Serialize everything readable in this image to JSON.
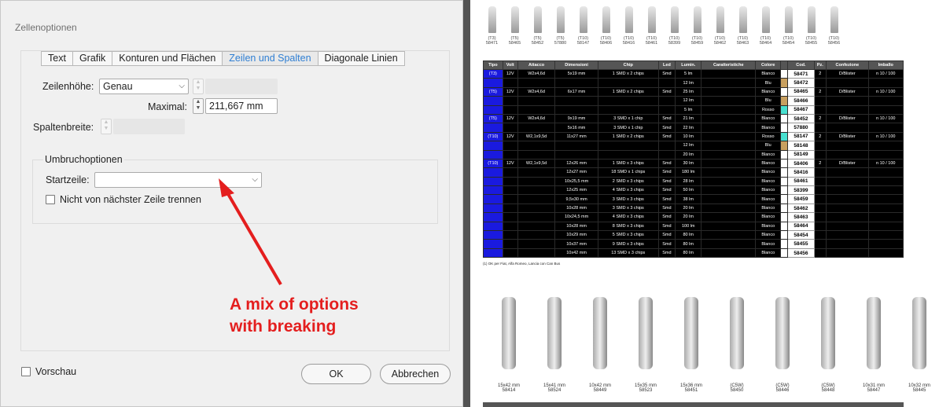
{
  "dialog": {
    "title": "Zellenoptionen",
    "tabs": [
      {
        "label": "Text"
      },
      {
        "label": "Grafik"
      },
      {
        "label": "Konturen und Flächen"
      },
      {
        "label": "Zeilen und Spalten",
        "active": true
      },
      {
        "label": "Diagonale Linien"
      }
    ],
    "row_height_label": "Zeilenhöhe:",
    "row_height_value": "Genau",
    "max_label": "Maximal:",
    "max_value": "211,667 mm",
    "col_width_label": "Spaltenbreite:",
    "break_group_title": "Umbruchoptionen",
    "start_row_label": "Startzeile:",
    "start_row_value": "",
    "keep_with_next_label": "Nicht von nächster Zeile trennen",
    "preview_label": "Vorschau",
    "ok_label": "OK",
    "cancel_label": "Abbrechen"
  },
  "annotation": {
    "line1": "A mix of options",
    "line2": "with breaking",
    "color": "#e41e1e"
  },
  "document": {
    "products": [
      {
        "type": "(T3)",
        "code": "58471"
      },
      {
        "type": "(T5)",
        "code": "58465"
      },
      {
        "type": "(T5)",
        "code": "58452"
      },
      {
        "type": "(T5)",
        "code": "57880"
      },
      {
        "type": "(T10)",
        "code": "58147"
      },
      {
        "type": "(T10)",
        "code": "58406"
      },
      {
        "type": "(T10)",
        "code": "58416"
      },
      {
        "type": "(T10)",
        "code": "58461"
      },
      {
        "type": "(T10)",
        "code": "58399"
      },
      {
        "type": "(T10)",
        "code": "58459"
      },
      {
        "type": "(T10)",
        "code": "58462"
      },
      {
        "type": "(T10)",
        "code": "58463"
      },
      {
        "type": "(T10)",
        "code": "58464"
      },
      {
        "type": "(T10)",
        "code": "58454"
      },
      {
        "type": "(T10)",
        "code": "58455"
      },
      {
        "type": "(T10)",
        "code": "58456"
      }
    ],
    "table_headers": [
      "Tipo",
      "Volt",
      "Attacco",
      "Dimensioni",
      "Chip",
      "Led",
      "Lumin.",
      "Caratteristiche",
      "Colore",
      "",
      "Cod.",
      "Pz.",
      "Confezione",
      "Imballo"
    ],
    "rows": [
      {
        "tipo": "(T3)",
        "volt": "12V",
        "att": "W2x4,6d",
        "dim": "5x19 mm",
        "chip": "1 SMD x 2 chips",
        "led": "Smd",
        "lum": "5 lm",
        "col": "Blanco",
        "cod": "58471",
        "pz": "2",
        "conf": "D/Blister",
        "imb": "n 10 / 100"
      },
      {
        "tipo": "",
        "volt": "",
        "att": "",
        "dim": "",
        "chip": "",
        "led": "",
        "lum": "12 lm",
        "col": "Blu",
        "cod": "58472",
        "pz": "",
        "conf": "",
        "imb": ""
      },
      {
        "tipo": "(T5)",
        "volt": "12V",
        "att": "W2x4,6d",
        "dim": "6x17 mm",
        "chip": "1 SMD x 2 chips",
        "led": "Smd",
        "lum": "25 lm",
        "col": "Blanco",
        "cod": "58465",
        "pz": "2",
        "conf": "D/Blister",
        "imb": "n 10 / 100"
      },
      {
        "tipo": "",
        "volt": "",
        "att": "",
        "dim": "",
        "chip": "",
        "led": "",
        "lum": "12 lm",
        "col": "Blu",
        "cod": "58466",
        "pz": "",
        "conf": "",
        "imb": ""
      },
      {
        "tipo": "",
        "volt": "",
        "att": "",
        "dim": "",
        "chip": "",
        "led": "",
        "lum": "5 lm",
        "col": "Rosso",
        "cod": "58467",
        "pz": "",
        "conf": "",
        "imb": ""
      },
      {
        "tipo": "(T5)",
        "volt": "12V",
        "att": "W2x4,6d",
        "dim": "9x19 mm",
        "chip": "3 SMD x 1 chip",
        "led": "Smd",
        "lum": "21 lm",
        "col": "Blanco",
        "cod": "58452",
        "pz": "2",
        "conf": "D/Blister",
        "imb": "n 10 / 100"
      },
      {
        "tipo": "",
        "volt": "",
        "att": "",
        "dim": "5x16 mm",
        "chip": "3 SMD x 1 chip",
        "led": "Smd",
        "lum": "22 lm",
        "col": "Blanco",
        "cod": "57880",
        "pz": "",
        "conf": "",
        "imb": ""
      },
      {
        "tipo": "(T10)",
        "volt": "12V",
        "att": "W2,1x9,5d",
        "dim": "11x27 mm",
        "chip": "1 SMD x 2 chips",
        "led": "Smd",
        "lum": "10 lm",
        "col": "Rosso",
        "cod": "58147",
        "pz": "2",
        "conf": "D/Blister",
        "imb": "n 10 / 100"
      },
      {
        "tipo": "",
        "volt": "",
        "att": "",
        "dim": "",
        "chip": "",
        "led": "",
        "lum": "12 lm",
        "col": "Blu",
        "cod": "58148",
        "pz": "",
        "conf": "",
        "imb": ""
      },
      {
        "tipo": "",
        "volt": "",
        "att": "",
        "dim": "",
        "chip": "",
        "led": "",
        "lum": "20 lm",
        "col": "Blanco",
        "cod": "58149",
        "pz": "",
        "conf": "",
        "imb": ""
      },
      {
        "tipo": "(T10)",
        "volt": "12V",
        "att": "W2,1x9,5d",
        "dim": "12x26 mm",
        "chip": "1 SMD x 3 chips",
        "led": "Smd",
        "lum": "30 lm",
        "col": "Blanco",
        "cod": "58406",
        "pz": "2",
        "conf": "D/Blister",
        "imb": "n 10 / 100"
      },
      {
        "tipo": "",
        "volt": "",
        "att": "",
        "dim": "12x27 mm",
        "chip": "18 SMD x 1 chips",
        "led": "Smd",
        "lum": "180 lm",
        "col": "Blanco",
        "cod": "58416",
        "pz": "",
        "conf": "",
        "imb": ""
      },
      {
        "tipo": "",
        "volt": "",
        "att": "",
        "dim": "10x25,5 mm",
        "chip": "2 SMD x 3 chips",
        "led": "Smd",
        "lum": "28 lm",
        "col": "Blanco",
        "cod": "58461",
        "pz": "",
        "conf": "",
        "imb": ""
      },
      {
        "tipo": "",
        "volt": "",
        "att": "",
        "dim": "12x25 mm",
        "chip": "4 SMD x 3 chips",
        "led": "Smd",
        "lum": "50 lm",
        "col": "Blanco",
        "cod": "58399",
        "pz": "",
        "conf": "",
        "imb": ""
      },
      {
        "tipo": "",
        "volt": "",
        "att": "",
        "dim": "9,5x30 mm",
        "chip": "3 SMD x 3 chips",
        "led": "Smd",
        "lum": "38 lm",
        "col": "Blanco",
        "cod": "58459",
        "pz": "",
        "conf": "",
        "imb": ""
      },
      {
        "tipo": "",
        "volt": "",
        "att": "",
        "dim": "10x28 mm",
        "chip": "3 SMD x 3 chips",
        "led": "Smd",
        "lum": "20 lm",
        "col": "Blanco",
        "cod": "58462",
        "pz": "",
        "conf": "",
        "imb": ""
      },
      {
        "tipo": "",
        "volt": "",
        "att": "",
        "dim": "10x24,5 mm",
        "chip": "4 SMD x 3 chips",
        "led": "Smd",
        "lum": "20 lm",
        "col": "Blanco",
        "cod": "58463",
        "pz": "",
        "conf": "",
        "imb": ""
      },
      {
        "tipo": "",
        "volt": "",
        "att": "",
        "dim": "10x28 mm",
        "chip": "8 SMD x 3 chips",
        "led": "Smd",
        "lum": "100 lm",
        "col": "Blanco",
        "cod": "58464",
        "pz": "",
        "conf": "",
        "imb": ""
      },
      {
        "tipo": "",
        "volt": "",
        "att": "",
        "dim": "10x29 mm",
        "chip": "5 SMD x 3 chips",
        "led": "Smd",
        "lum": "80 lm",
        "col": "Blanco",
        "cod": "58454",
        "pz": "",
        "conf": "",
        "imb": ""
      },
      {
        "tipo": "",
        "volt": "",
        "att": "",
        "dim": "10x37 mm",
        "chip": "9 SMD x 3 chips",
        "led": "Smd",
        "lum": "80 lm",
        "col": "Blanco",
        "cod": "58455",
        "pz": "",
        "conf": "",
        "imb": ""
      },
      {
        "tipo": "",
        "volt": "",
        "att": "",
        "dim": "10x42 mm",
        "chip": "13 SMD x 3 chips",
        "led": "Smd",
        "lum": "80 lm",
        "col": "Blanco",
        "cod": "58456",
        "pz": "",
        "conf": "",
        "imb": ""
      }
    ],
    "footnote": "(1) OK per Fiat, Alfa Romeo, Lancia con Can Bus",
    "festoons": [
      {
        "size": "15x42 mm",
        "code": "58414"
      },
      {
        "size": "15x41 mm",
        "code": "58524"
      },
      {
        "size": "10x42 mm",
        "code": "58449"
      },
      {
        "size": "15x35 mm",
        "code": "58523"
      },
      {
        "size": "15x36 mm",
        "code": "58451"
      },
      {
        "size": "(C5W)",
        "code": "58450"
      },
      {
        "size": "(C5W)",
        "code": "58446"
      },
      {
        "size": "(C5W)",
        "code": "58448"
      },
      {
        "size": "10x31 mm",
        "code": "58447"
      },
      {
        "size": "10x32 mm",
        "code": "58445"
      }
    ]
  }
}
